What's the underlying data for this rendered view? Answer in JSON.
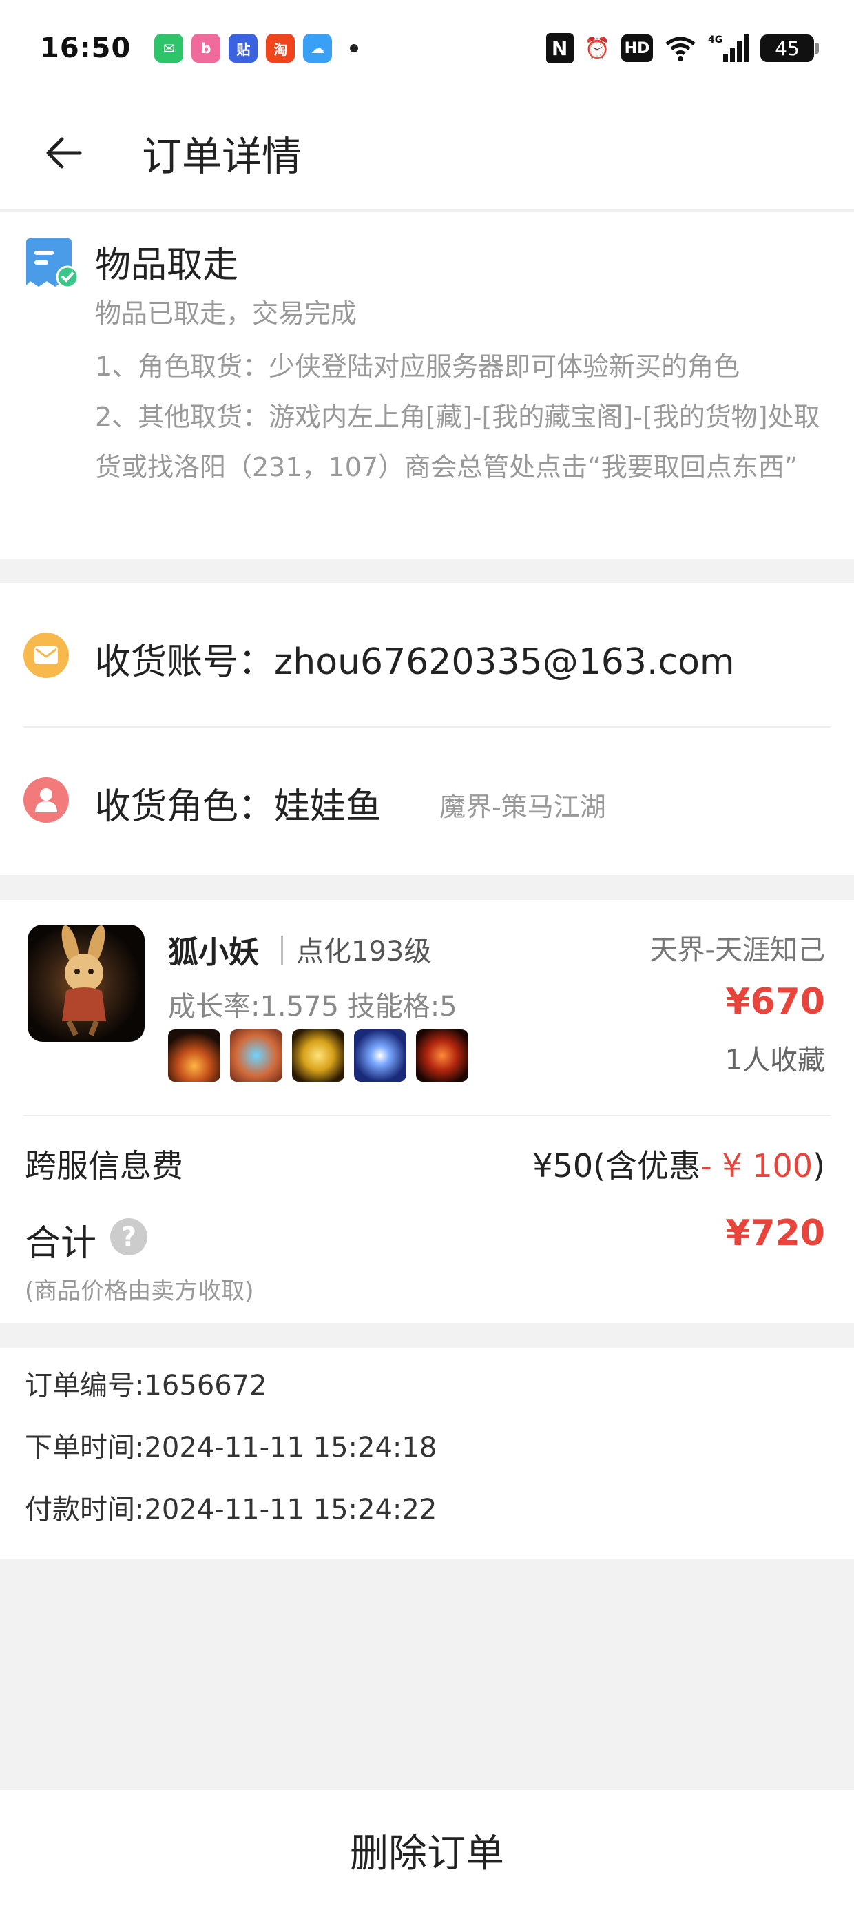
{
  "status_bar": {
    "time": "16:50",
    "apps": [
      {
        "icon": "message-app-icon",
        "color": "#2ec56a",
        "glyph": "✉"
      },
      {
        "icon": "bilibili-app-icon",
        "color": "#f06b9b",
        "glyph": "b"
      },
      {
        "icon": "tieba-app-icon",
        "color": "#3b63e0",
        "glyph": "贴"
      },
      {
        "icon": "taobao-app-icon",
        "color": "#f0451c",
        "glyph": "淘"
      },
      {
        "icon": "weather-app-icon",
        "color": "#3aa0f5",
        "glyph": "☁"
      }
    ],
    "network": "4G",
    "hd": "HD",
    "battery": "45"
  },
  "header": {
    "title": "订单详情"
  },
  "pickup": {
    "title": "物品取走",
    "subtitle": "物品已取走，交易完成",
    "step1": "1、角色取货：少侠登陆对应服务器即可体验新买的角色",
    "step2": "2、其他取货：游戏内左上角[藏]-[我的藏宝阁]-[我的货物]处取货或找洛阳（231，107）商会总管处点击“我要取回点东西”"
  },
  "account": {
    "account_label": "收货账号：zhou67620335@163.com",
    "role_label": "收货角色：娃娃鱼",
    "role_server": "魔界-策马江湖"
  },
  "item": {
    "name": "狐小妖",
    "level": "点化193级",
    "server": "天界-天涯知己",
    "growth": "成长率:1.575 技能格:5",
    "price": "¥670",
    "favorites": "1人收藏",
    "fee_label": "跨服信息费",
    "fee_value": "¥50(含优惠",
    "fee_discount": "- ¥ 100",
    "fee_close": ")",
    "total_label": "合计",
    "total_value": "¥720",
    "total_note": "(商品价格由卖方收取)"
  },
  "order_info": {
    "order_no": "订单编号:1656672",
    "order_time": "下单时间:2024-11-11 15:24:18",
    "pay_time": "付款时间:2024-11-11 15:24:22"
  },
  "footer": {
    "delete_label": "删除订单"
  },
  "colors": {
    "accent_price": "#e8443b",
    "mail_icon": "#f7b94c",
    "user_icon": "#f27a7a",
    "doc_icon": "#4a9be8"
  }
}
